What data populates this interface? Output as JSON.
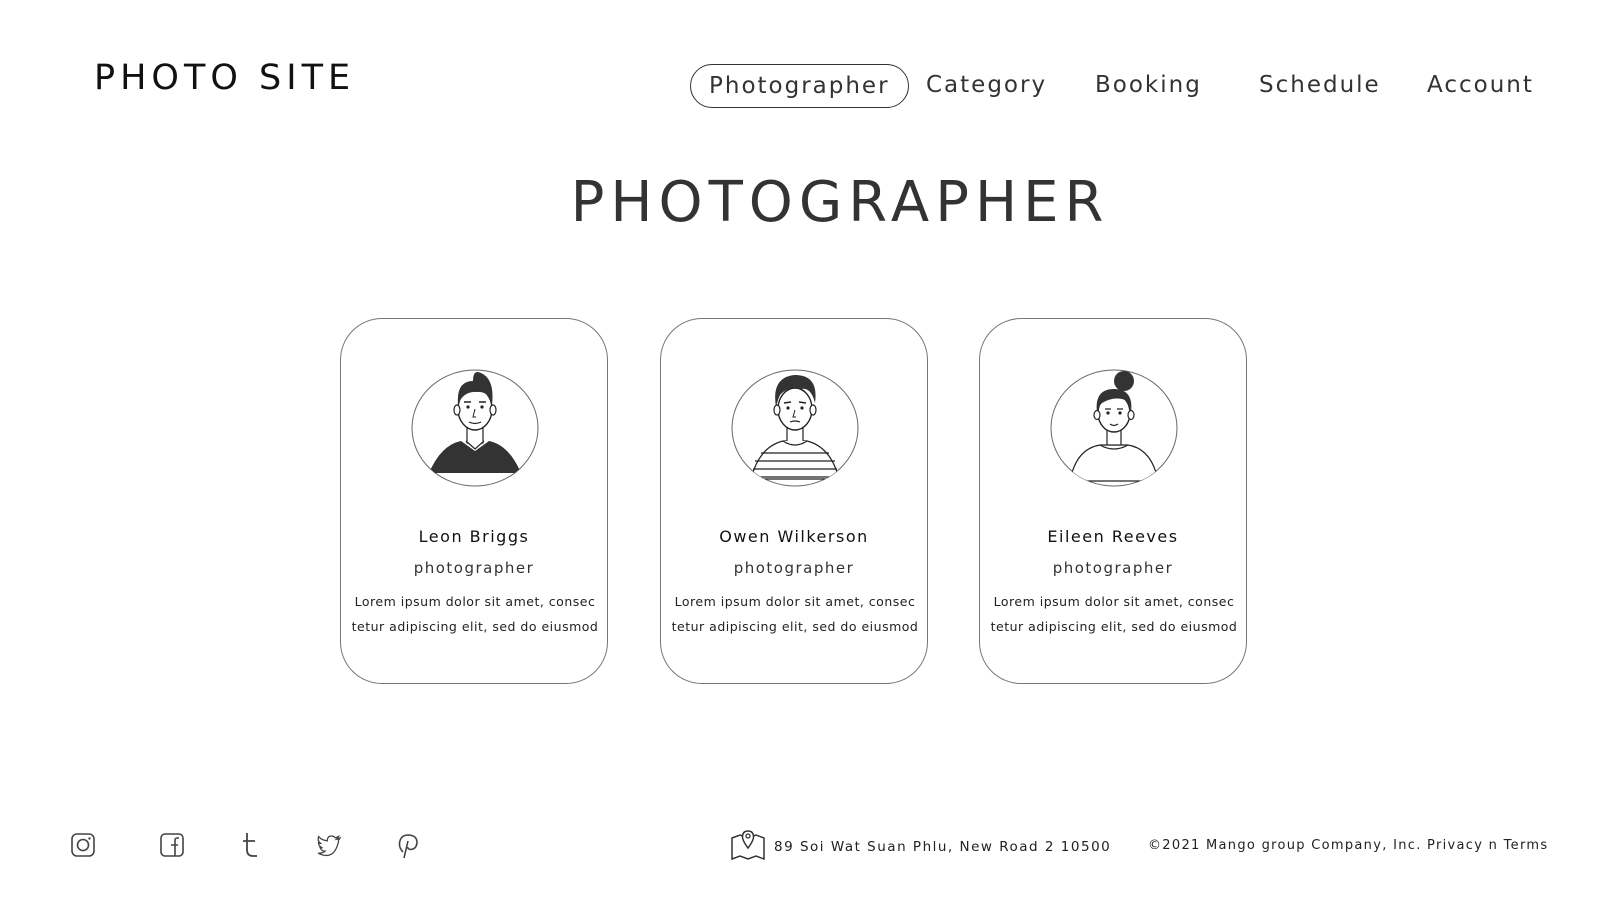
{
  "header": {
    "logo": "PHOTO SITE",
    "nav": [
      {
        "label": "Photographer",
        "active": true
      },
      {
        "label": "Category",
        "active": false
      },
      {
        "label": "Booking",
        "active": false
      },
      {
        "label": "Schedule",
        "active": false
      },
      {
        "label": "Account",
        "active": false
      }
    ]
  },
  "main": {
    "title": "PHOTOGRAPHER",
    "cards": [
      {
        "avatar_icon": "man-dark-shirt-avatar-icon",
        "name": "Leon Briggs",
        "role": "photographer",
        "description_line1": "Lorem ipsum dolor sit amet, consec",
        "description_line2": "tetur adipiscing elit, sed do eiusmod"
      },
      {
        "avatar_icon": "man-striped-shirt-avatar-icon",
        "name": "Owen Wilkerson",
        "role": "photographer",
        "description_line1": "Lorem ipsum dolor sit amet, consec",
        "description_line2": "tetur adipiscing elit, sed do eiusmod"
      },
      {
        "avatar_icon": "woman-hair-bun-avatar-icon",
        "name": "Eileen Reeves",
        "role": "photographer",
        "description_line1": "Lorem ipsum dolor sit amet, consec",
        "description_line2": "tetur adipiscing elit, sed do eiusmod"
      }
    ]
  },
  "footer": {
    "social_icons": [
      "instagram-icon",
      "facebook-icon",
      "tumblr-icon",
      "twitter-icon",
      "pinterest-icon"
    ],
    "address_icon": "map-pin-icon",
    "address": "89 Soi Wat Suan Phlu, New Road 2 10500",
    "copyright": "©2021 Mango group Company, Inc. Privacy n Terms"
  },
  "colors": {
    "text": "#222222",
    "border": "#777777",
    "background": "#ffffff",
    "avatar_fill": "#333333"
  }
}
